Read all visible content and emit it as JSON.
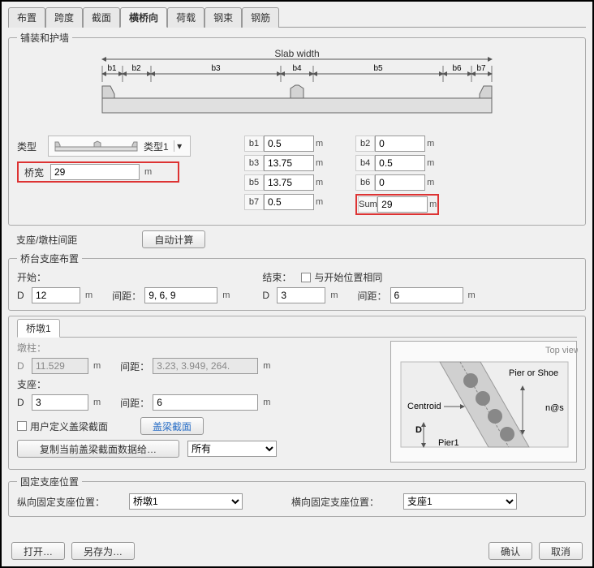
{
  "tabs": {
    "items": [
      "布置",
      "跨度",
      "截面",
      "横桥向",
      "荷载",
      "钢束",
      "钢筋"
    ],
    "active": 3
  },
  "group1": {
    "legend": "铺装和护墙",
    "diagram": {
      "slab_width_label": "Slab width",
      "blabels": [
        "b1",
        "b2",
        "b3",
        "b4",
        "b5",
        "b6",
        "b7"
      ]
    },
    "type_label": "类型",
    "type_value": "类型1",
    "bridge_width_label": "桥宽",
    "bridge_width_value": "29",
    "bridge_width_unit": "m",
    "dims": {
      "b1": {
        "value": "0.5",
        "unit": "m"
      },
      "b2": {
        "value": "0",
        "unit": "m"
      },
      "b3": {
        "value": "13.75",
        "unit": "m"
      },
      "b4": {
        "value": "0.5",
        "unit": "m"
      },
      "b5": {
        "value": "13.75",
        "unit": "m"
      },
      "b6": {
        "value": "0",
        "unit": "m"
      },
      "b7": {
        "value": "0.5",
        "unit": "m"
      },
      "sum": {
        "label": "Sum",
        "value": "29",
        "unit": "m"
      }
    }
  },
  "spacing": {
    "label": "支座/墩柱间距",
    "auto_btn": "自动计算"
  },
  "abutment": {
    "legend": "桥台支座布置",
    "start_label": "开始：",
    "end_label": "结束：",
    "same_as_start": "与开始位置相同",
    "D_label": "D",
    "start_D": "12",
    "gap_label": "间距：",
    "start_gap": "9, 6, 9",
    "end_D": "3",
    "end_gap": "6",
    "unit": "m"
  },
  "pier": {
    "tab_label": "桥墩1",
    "col_label": "墩柱：",
    "D_label": "D",
    "col_D": "11.529",
    "gap_label": "间距：",
    "col_gap": "3.23, 3.949, 264.",
    "seat_label": "支座：",
    "seat_D": "3",
    "seat_gap": "6",
    "unit": "m",
    "user_section_chk": "用户定义盖梁截面",
    "cap_section_btn": "盖梁截面",
    "copy_btn": "复制当前盖梁截面数据给…",
    "copy_target": "所有",
    "topview": {
      "title": "Top view",
      "pier_or_shoe": "Pier or Shoe",
      "centroid": "Centroid",
      "nas": "n@s",
      "D": "D",
      "pier1": "Pier1"
    }
  },
  "fixed": {
    "legend": "固定支座位置",
    "long_label": "纵向固定支座位置：",
    "long_value": "桥墩1",
    "trans_label": "横向固定支座位置：",
    "trans_value": "支座1"
  },
  "footer": {
    "open": "打开…",
    "save_as": "另存为…",
    "ok": "确认",
    "cancel": "取消"
  }
}
